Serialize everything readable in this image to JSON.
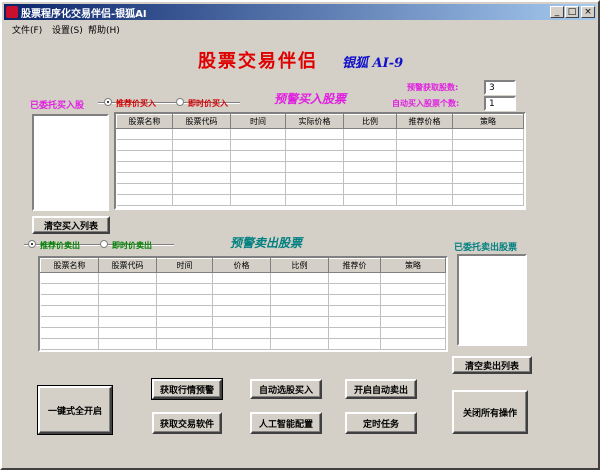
{
  "window": {
    "title": "股票程序化交易伴侣-银狐AI",
    "controls": {
      "minimize": "_",
      "maximize": "□",
      "close": "×"
    }
  },
  "menu": {
    "items": [
      "文件(F)",
      "设置(S)",
      "帮助(H)"
    ]
  },
  "header": {
    "title": "股票交易伴侣",
    "subtitle": "银狐 AI-9"
  },
  "settings": {
    "fetch_count_label": "预警获取股数:",
    "fetch_count_value": "3",
    "auto_buy_count_label": "自动买入股票个数:",
    "auto_buy_count_value": "1"
  },
  "buy": {
    "entrusted_label": "已委托买入股",
    "radio_recommend": "推荐价买入",
    "radio_instant": "即时价买入",
    "section_title": "预警买入股票",
    "columns": [
      "股票名称",
      "股票代码",
      "时间",
      "实际价格",
      "比例",
      "推荐价格",
      "策略"
    ],
    "clear_button": "清空买入列表"
  },
  "sell": {
    "radio_recommend": "推荐价卖出",
    "radio_instant": "即时价卖出",
    "section_title": "预警卖出股票",
    "entrusted_label": "已委托卖出股票",
    "columns": [
      "股票名称",
      "股票代码",
      "时间",
      "价格",
      "比例",
      "推荐价",
      "策略"
    ],
    "clear_button": "清空卖出列表"
  },
  "actions": {
    "start_all": "一键式全开启",
    "fetch_alert": "获取行情预警",
    "auto_select_buy": "自动选股买入",
    "auto_sell": "开启自动卖出",
    "fetch_trade_software": "获取交易软件",
    "ai_config": "人工智能配置",
    "timed_task": "定时任务",
    "close_all": "关闭所有操作"
  }
}
